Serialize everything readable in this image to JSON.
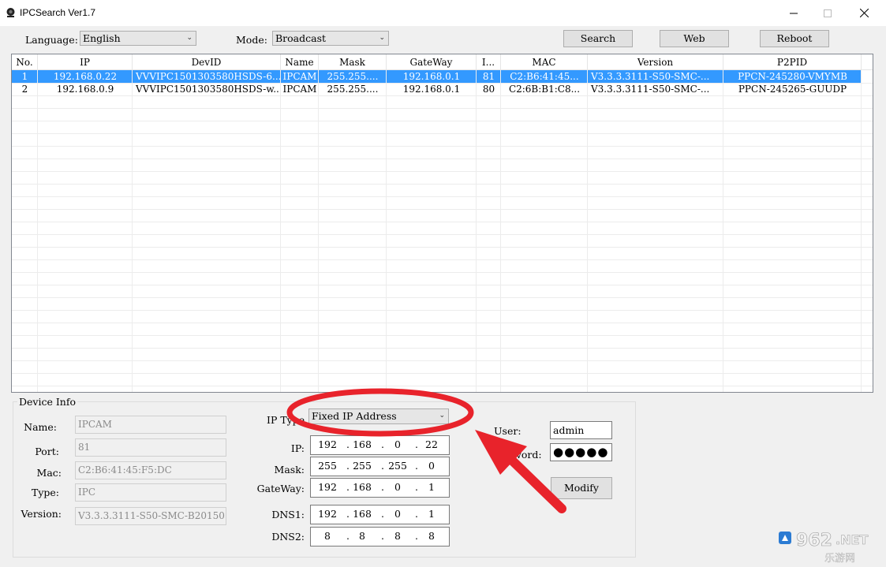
{
  "window": {
    "title": "IPCSearch Ver1.7"
  },
  "toolbar": {
    "language_label": "Language:",
    "language_value": "English",
    "mode_label": "Mode:",
    "mode_value": "Broadcast",
    "search_label": "Search",
    "web_label": "Web",
    "reboot_label": "Reboot"
  },
  "table": {
    "columns": [
      "No.",
      "IP",
      "DevID",
      "Name",
      "Mask",
      "GateWay",
      "I...",
      "MAC",
      "Version",
      "P2PID"
    ],
    "rows": [
      [
        "1",
        "192.168.0.22",
        "VVVIPC1501303580HSDS-6...",
        "IPCAM",
        "255.255....",
        "192.168.0.1",
        "81",
        "C2:B6:41:45...",
        "V3.3.3.3111-S50-SMC-...",
        "PPCN-245280-VMYMB"
      ],
      [
        "2",
        "192.168.0.9",
        "VVVIPC1501303580HSDS-w...",
        "IPCAM",
        "255.255....",
        "192.168.0.1",
        "80",
        "C2:6B:B1:C8...",
        "V3.3.3.3111-S50-SMC-...",
        "PPCN-245265-GUUDP"
      ]
    ],
    "selected_row": 0
  },
  "device_info": {
    "group_title": "Device Info",
    "name_label": "Name:",
    "name_value": "IPCAM",
    "port_label": "Port:",
    "port_value": "81",
    "mac_label": "Mac:",
    "mac_value": "C2:B6:41:45:F5:DC",
    "type_label": "Type:",
    "type_value": "IPC",
    "version_label": "Version:",
    "version_value": "V3.3.3.3111-S50-SMC-B20150",
    "iptype_label": "IP Type",
    "iptype_value": "Fixed IP Address",
    "ip_label": "IP:",
    "ip": [
      "192",
      "168",
      "0",
      "22"
    ],
    "mask_label": "Mask:",
    "mask": [
      "255",
      "255",
      "255",
      "0"
    ],
    "gateway_label": "GateWay:",
    "gateway": [
      "192",
      "168",
      "0",
      "1"
    ],
    "dns1_label": "DNS1:",
    "dns1": [
      "192",
      "168",
      "0",
      "1"
    ],
    "dns2_label": "DNS2:",
    "dns2": [
      "8",
      "8",
      "8",
      "8"
    ],
    "user_label": "User:",
    "user_value": "admin",
    "password_label": "Password:",
    "password_mask": "●●●●●",
    "modify_label": "Modify"
  },
  "watermark": {
    "text1": "962",
    "text2": ".NET",
    "text3": "乐游网"
  },
  "colors": {
    "selection": "#3399ff",
    "annotation_red": "#e8232b"
  }
}
